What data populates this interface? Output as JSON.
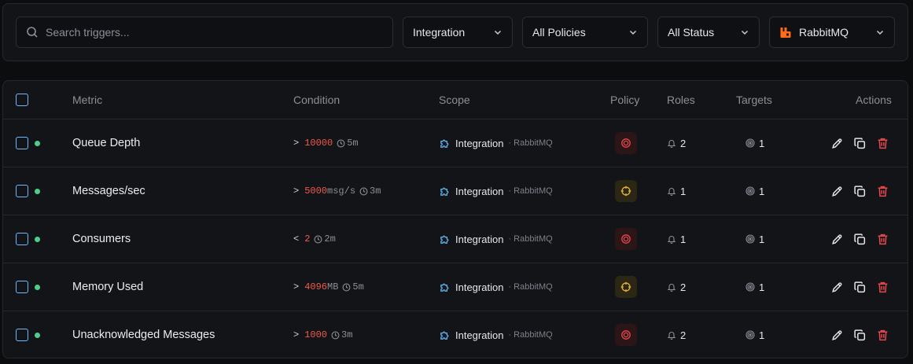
{
  "search": {
    "placeholder": "Search triggers..."
  },
  "filters": {
    "integration": "Integration",
    "policies": "All Policies",
    "status": "All Status",
    "source": "RabbitMQ"
  },
  "columns": {
    "metric": "Metric",
    "condition": "Condition",
    "scope": "Scope",
    "policy": "Policy",
    "roles": "Roles",
    "targets": "Targets",
    "actions": "Actions"
  },
  "rows": [
    {
      "metric": "Queue Depth",
      "operator": ">",
      "threshold": "10000",
      "unit": "",
      "duration": "5m",
      "scope": "Integration",
      "scope_detail": "· RabbitMQ",
      "policy": "critical",
      "roles": "2",
      "targets": "1"
    },
    {
      "metric": "Messages/sec",
      "operator": ">",
      "threshold": "5000",
      "unit": "msg/s",
      "duration": "3m",
      "scope": "Integration",
      "scope_detail": "· RabbitMQ",
      "policy": "warning",
      "roles": "1",
      "targets": "1"
    },
    {
      "metric": "Consumers",
      "operator": "<",
      "threshold": "2",
      "unit": "",
      "duration": "2m",
      "scope": "Integration",
      "scope_detail": "· RabbitMQ",
      "policy": "critical",
      "roles": "1",
      "targets": "1"
    },
    {
      "metric": "Memory Used",
      "operator": ">",
      "threshold": "4096",
      "unit": "MB",
      "duration": "5m",
      "scope": "Integration",
      "scope_detail": "· RabbitMQ",
      "policy": "warning",
      "roles": "2",
      "targets": "1"
    },
    {
      "metric": "Unacknowledged Messages",
      "operator": ">",
      "threshold": "1000",
      "unit": "",
      "duration": "3m",
      "scope": "Integration",
      "scope_detail": "· RabbitMQ",
      "policy": "critical",
      "roles": "2",
      "targets": "1"
    }
  ],
  "colors": {
    "critical": "#e5484d",
    "warning": "#e5b53a",
    "status_active": "#4ccf8a",
    "threshold": "#ef5a4f",
    "checkbox": "#6fb7ff",
    "rabbitmq": "#ff6b1a",
    "delete": "#e5484d"
  },
  "icons": {
    "policy_critical": "target-icon",
    "policy_warning": "crosshair-icon",
    "roles": "bell-icon",
    "targets": "radar-icon",
    "scope": "puzzle-icon",
    "duration": "clock-icon",
    "edit": "pencil-icon",
    "duplicate": "copy-icon",
    "delete": "trash-icon"
  }
}
